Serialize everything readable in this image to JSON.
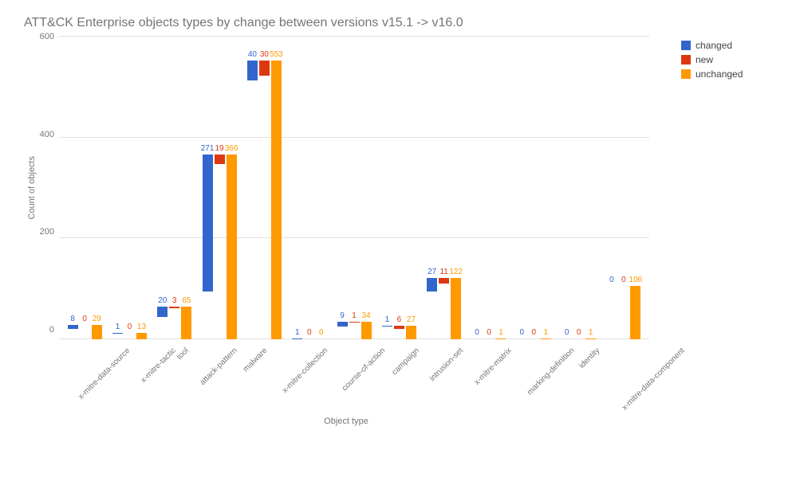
{
  "chart_data": {
    "type": "bar",
    "title": "ATT&CK Enterprise objects types by change between versions v15.1 -> v16.0",
    "xlabel": "Object type",
    "ylabel": "Count of objects",
    "ylim": [
      0,
      600
    ],
    "yticks": [
      0,
      200,
      400,
      600
    ],
    "categories": [
      "x-mitre-data-source",
      "x-mitre-tactic",
      "tool",
      "attack-pattern",
      "malware",
      "x-mitre-collection",
      "course-of-action",
      "campaign",
      "intrusion-set",
      "x-mitre-matrix",
      "marking-definition",
      "identity",
      "x-mitre-data-component"
    ],
    "series": [
      {
        "name": "changed",
        "color": "#3366cc",
        "values": [
          8,
          1,
          20,
          271,
          40,
          1,
          9,
          1,
          27,
          0,
          0,
          0,
          0
        ]
      },
      {
        "name": "new",
        "color": "#dc3912",
        "values": [
          0,
          0,
          3,
          19,
          30,
          0,
          1,
          6,
          11,
          0,
          0,
          0,
          0
        ]
      },
      {
        "name": "unchanged",
        "color": "#ff9900",
        "values": [
          29,
          13,
          65,
          366,
          553,
          0,
          34,
          27,
          122,
          1,
          1,
          1,
          106
        ]
      }
    ],
    "legend": [
      "changed",
      "new",
      "unchanged"
    ]
  }
}
